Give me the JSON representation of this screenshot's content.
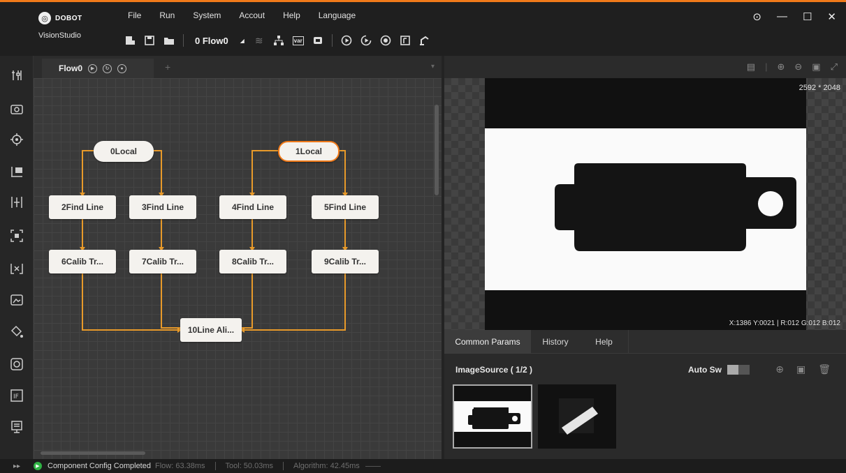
{
  "app": {
    "brand": "DOBOT",
    "product": "VisionStudio"
  },
  "menu": [
    "File",
    "Run",
    "System",
    "Accout",
    "Help",
    "Language"
  ],
  "toolbar": {
    "flow_selector": "0 Flow0"
  },
  "flow_panel": {
    "tab_label": "Flow0",
    "nodes": [
      {
        "id": "n0",
        "label": "0Local"
      },
      {
        "id": "n1",
        "label": "1Local"
      },
      {
        "id": "n2",
        "label": "2Find Line"
      },
      {
        "id": "n3",
        "label": "3Find Line"
      },
      {
        "id": "n4",
        "label": "4Find Line"
      },
      {
        "id": "n5",
        "label": "5Find Line"
      },
      {
        "id": "n6",
        "label": "6Calib Tr..."
      },
      {
        "id": "n7",
        "label": "7Calib Tr..."
      },
      {
        "id": "n8",
        "label": "8Calib Tr..."
      },
      {
        "id": "n9",
        "label": "9Calib Tr..."
      },
      {
        "id": "n10",
        "label": "10Line Ali..."
      }
    ]
  },
  "viewer": {
    "dimensions": "2592 * 2048",
    "pixel_info": "X:1386 Y:0021 | R:012 G:012 B:012"
  },
  "params_panel": {
    "tabs": [
      "Common Params",
      "History",
      "Help"
    ],
    "selected_tab": "Common Params",
    "image_source": "ImageSource ( 1/2 )",
    "auto_switch_label": "Auto Sw"
  },
  "status": {
    "message": "Component Config Completed",
    "flow": "Flow: 63.38ms",
    "tool": "Tool: 50.03ms",
    "algorithm": "Algorithm: 42.45ms"
  },
  "colors": {
    "accent": "#f07a1a",
    "status_ok": "#2fb344"
  }
}
